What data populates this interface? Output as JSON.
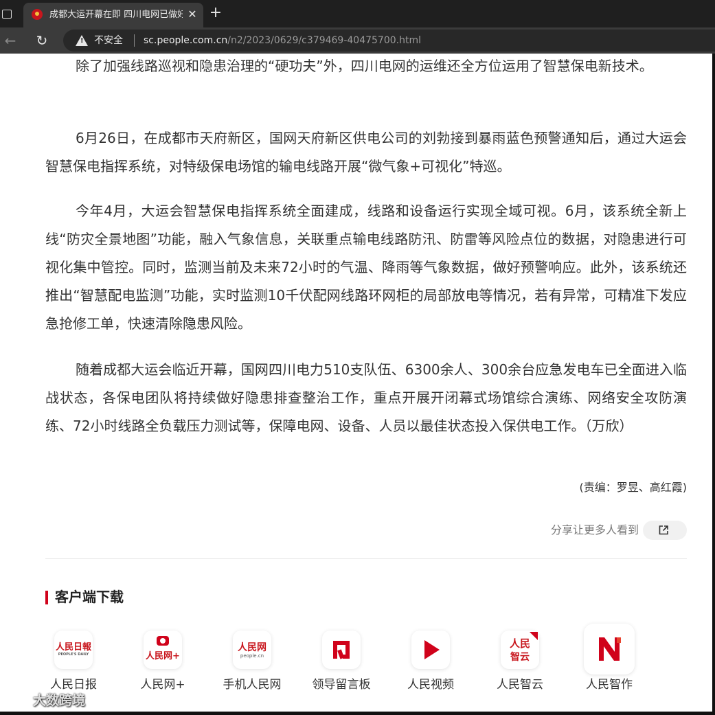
{
  "browser": {
    "tab_title": "成都大运开幕在即 四川电网已做好",
    "tab_close": "✕",
    "new_tab": "+",
    "back": "←",
    "reload": "↻",
    "security_label": "不安全",
    "url_host": "sc.people.com.cn",
    "url_path": "/n2/2023/0629/c379469-40475700.html"
  },
  "article": {
    "paragraphs": [
      "除了加强线路巡视和隐患治理的“硬功夫”外，四川电网的运维还全方位运用了智慧保电新技术。",
      "6月26日，在成都市天府新区，国网天府新区供电公司的刘勃接到暴雨蓝色预警通知后，通过大运会智慧保电指挥系统，对特级保电场馆的输电线路开展“微气象+可视化”特巡。",
      "今年4月，大运会智慧保电指挥系统全面建成，线路和设备运行实现全域可视。6月，该系统全新上线“防灾全景地图”功能，融入气象信息，关联重点输电线路防汛、防雷等风险点位的数据，对隐患进行可视化集中管控。同时，监测当前及未来72小时的气温、降雨等气象数据，做好预警响应。此外，该系统还推出“智慧配电监测”功能，实时监测10千伏配网线路环网柜的局部放电等情况，若有异常，可精准下发应急抢修工单，快速清除隐患风险。",
      "随着成都大运会临近开幕，国网四川电力510支队伍、6300余人、300余台应急发电车已全面进入临战状态，各保电团队将持续做好隐患排查整治工作，重点开展开闭幕式场馆综合演练、网络安全攻防演练、72小时线路全负载压力测试等，保障电网、设备、人员以最佳状态投入保供电工作。（万欣）"
    ],
    "editor": "(责编：罗昱、高红霞)",
    "share_text": "分享让更多人看到"
  },
  "downloads": {
    "title": "客户端下载",
    "apps": [
      {
        "label": "人民日报",
        "icon": "people-daily-icon",
        "icon_text": "人民日報",
        "icon_sub": "PEOPLE'S DAILY"
      },
      {
        "label": "人民网+",
        "icon": "people-net-plus-icon",
        "icon_text": "人民网+",
        "icon_sub": ""
      },
      {
        "label": "手机人民网",
        "icon": "mobile-people-net-icon",
        "icon_text": "人民网",
        "icon_sub": "people.cn"
      },
      {
        "label": "领导留言板",
        "icon": "leader-message-board-icon",
        "icon_text": "",
        "icon_sub": ""
      },
      {
        "label": "人民视频",
        "icon": "people-video-icon",
        "icon_text": "",
        "icon_sub": ""
      },
      {
        "label": "人民智云",
        "icon": "people-smart-cloud-icon",
        "icon_text": "人民",
        "icon_sub": "智云"
      },
      {
        "label": "人民智作",
        "icon": "people-smart-create-icon",
        "icon_text": "",
        "icon_sub": ""
      }
    ]
  },
  "watermark": "大数跨境",
  "colors": {
    "accent": "#d0021b",
    "brand_red": "#c8161d",
    "text": "#333333",
    "chrome_dark": "#1f1f1f",
    "chrome_toolbar": "#3b3b3b"
  }
}
